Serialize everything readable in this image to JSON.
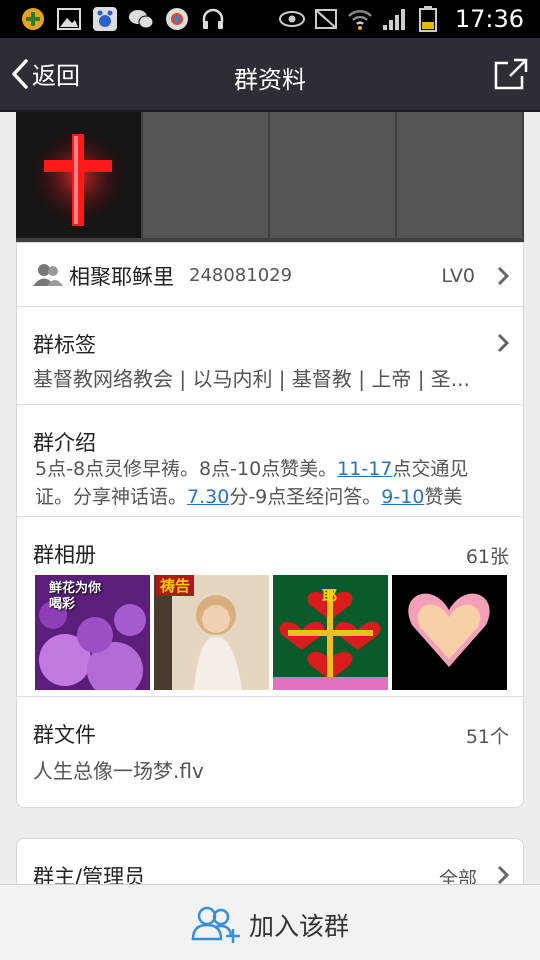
{
  "status_bar": {
    "time": "17:36",
    "left_icons": [
      "plus-app-icon",
      "gallery-icon",
      "baidu-icon",
      "wechat-icon",
      "browser-icon",
      "headphones-icon"
    ],
    "right_icons": [
      "eye-icon",
      "mute-icon",
      "wifi-icon",
      "signal-icon",
      "battery-icon"
    ]
  },
  "header": {
    "back_label": "返回",
    "title": "群资料"
  },
  "group": {
    "name": "相聚耶稣里",
    "id": "248081029",
    "level": "LV0"
  },
  "tags": {
    "label": "群标签",
    "value": "基督教网络教会 | 以马内利 | 基督教 | 上帝 | 圣..."
  },
  "intro": {
    "label": "群介绍",
    "line1_a": "5点-8点灵修早祷。8点-10点赞美。",
    "line1_link": "11-17",
    "line1_b": "点交通见",
    "line2_a": "证。分享神话语。",
    "line2_link1": "7.30",
    "line2_b": "分-9点圣经问答。",
    "line2_link2": "9-10",
    "line2_c": "赞美"
  },
  "album": {
    "label": "群相册",
    "count": "61张",
    "thumbs": [
      {
        "name": "flower-photo",
        "caption": "鲜花为你喝彩"
      },
      {
        "name": "prayer-girl-photo",
        "caption": "祷告"
      },
      {
        "name": "hearts-cross-photo",
        "caption": "耶"
      },
      {
        "name": "heart-photo",
        "caption": ""
      }
    ]
  },
  "files": {
    "label": "群文件",
    "count": "51个",
    "latest": "人生总像一场梦.flv"
  },
  "admins": {
    "label": "群主/管理员",
    "value": "全部"
  },
  "join": {
    "label": "加入该群"
  },
  "colors": {
    "title_bar": "#2b2f35",
    "link": "#2a72c2",
    "join_icon": "#3a8ed8"
  }
}
